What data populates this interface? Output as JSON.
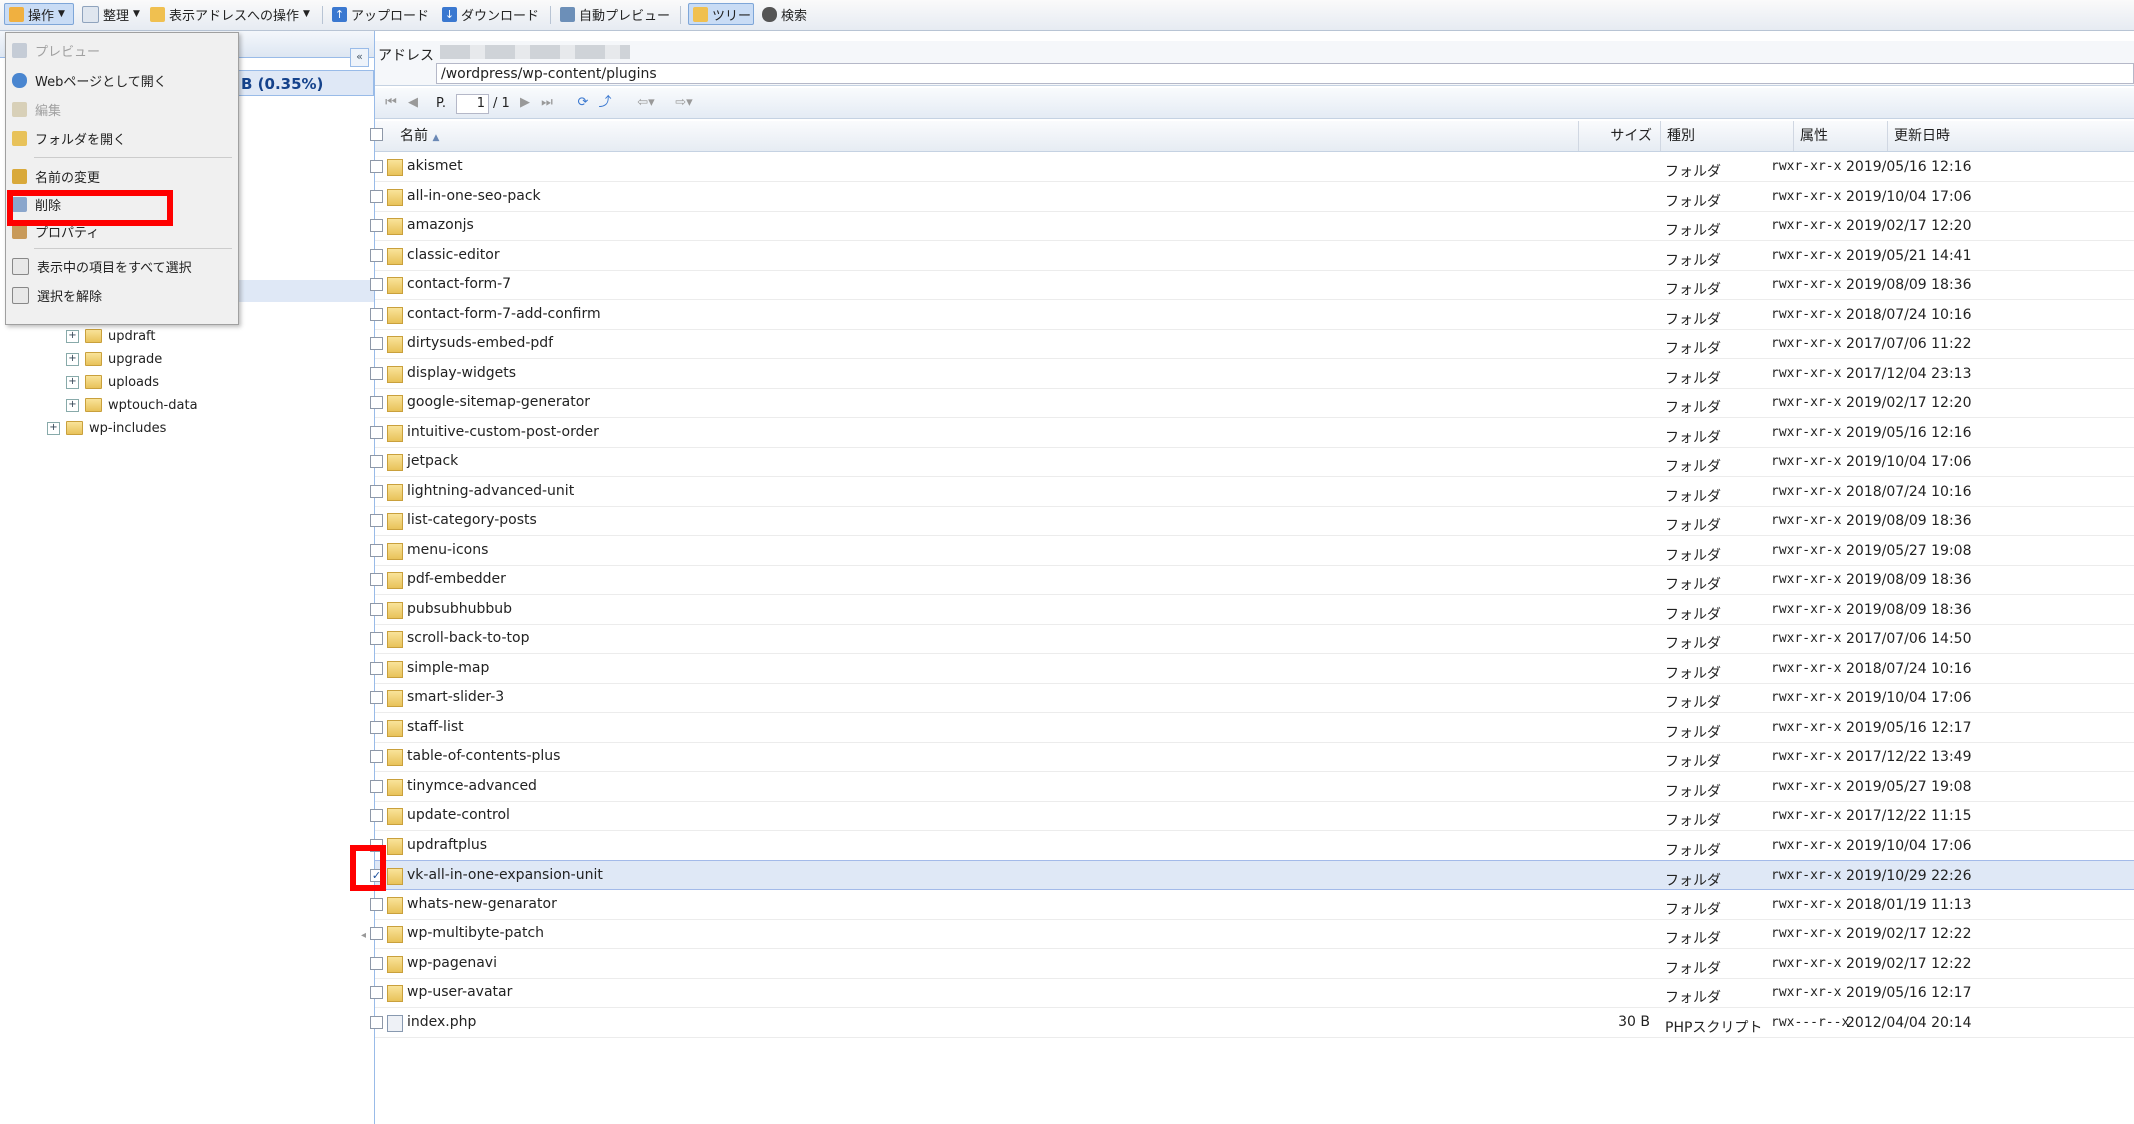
{
  "toolbar": {
    "operation": "操作",
    "organize": "整理",
    "address_ops": "表示アドレスへの操作",
    "upload": "アップロード",
    "download": "ダウンロード",
    "auto_preview": "自動プレビュー",
    "tree": "ツリー",
    "search": "検索"
  },
  "menu": {
    "items": [
      {
        "label": "プレビュー",
        "icon": "monitor-icon",
        "disabled": true
      },
      {
        "label": "Webページとして開く",
        "icon": "globe-page-icon",
        "disabled": false
      },
      {
        "label": "編集",
        "icon": "pencil-icon",
        "disabled": true
      },
      {
        "label": "フォルダを開く",
        "icon": "folder-open-icon",
        "disabled": false
      },
      {
        "label": "名前の変更",
        "icon": "pencil-icon",
        "disabled": false
      },
      {
        "label": "削除",
        "icon": "delete-icon",
        "disabled": false
      },
      {
        "label": "プロパティ",
        "icon": "properties-icon",
        "disabled": false
      },
      {
        "label": "表示中の項目をすべて選択",
        "icon": "cursor-icon",
        "disabled": false
      },
      {
        "label": "選択を解除",
        "icon": "cursor-icon",
        "disabled": false
      }
    ]
  },
  "left": {
    "quota": "B (0.35%)",
    "tree": [
      "updraft",
      "upgrade",
      "uploads",
      "wptouch-data",
      "wp-includes"
    ]
  },
  "address": {
    "label": "アドレス",
    "path": "/wordpress/wp-content/plugins"
  },
  "pager": {
    "prefix": "P.",
    "page": "1",
    "total": "/ 1"
  },
  "columns": {
    "name": "名前",
    "size": "サイズ",
    "type": "種別",
    "perm": "属性",
    "date": "更新日時"
  },
  "rows": [
    {
      "name": "akismet",
      "size": "",
      "type": "フォルダ",
      "perm": "rwxr-xr-x",
      "date": "2019/05/16 12:16",
      "checked": false
    },
    {
      "name": "all-in-one-seo-pack",
      "size": "",
      "type": "フォルダ",
      "perm": "rwxr-xr-x",
      "date": "2019/10/04 17:06",
      "checked": false
    },
    {
      "name": "amazonjs",
      "size": "",
      "type": "フォルダ",
      "perm": "rwxr-xr-x",
      "date": "2019/02/17 12:20",
      "checked": false
    },
    {
      "name": "classic-editor",
      "size": "",
      "type": "フォルダ",
      "perm": "rwxr-xr-x",
      "date": "2019/05/21 14:41",
      "checked": false
    },
    {
      "name": "contact-form-7",
      "size": "",
      "type": "フォルダ",
      "perm": "rwxr-xr-x",
      "date": "2019/08/09 18:36",
      "checked": false
    },
    {
      "name": "contact-form-7-add-confirm",
      "size": "",
      "type": "フォルダ",
      "perm": "rwxr-xr-x",
      "date": "2018/07/24 10:16",
      "checked": false
    },
    {
      "name": "dirtysuds-embed-pdf",
      "size": "",
      "type": "フォルダ",
      "perm": "rwxr-xr-x",
      "date": "2017/07/06 11:22",
      "checked": false
    },
    {
      "name": "display-widgets",
      "size": "",
      "type": "フォルダ",
      "perm": "rwxr-xr-x",
      "date": "2017/12/04 23:13",
      "checked": false
    },
    {
      "name": "google-sitemap-generator",
      "size": "",
      "type": "フォルダ",
      "perm": "rwxr-xr-x",
      "date": "2019/02/17 12:20",
      "checked": false
    },
    {
      "name": "intuitive-custom-post-order",
      "size": "",
      "type": "フォルダ",
      "perm": "rwxr-xr-x",
      "date": "2019/05/16 12:16",
      "checked": false
    },
    {
      "name": "jetpack",
      "size": "",
      "type": "フォルダ",
      "perm": "rwxr-xr-x",
      "date": "2019/10/04 17:06",
      "checked": false
    },
    {
      "name": "lightning-advanced-unit",
      "size": "",
      "type": "フォルダ",
      "perm": "rwxr-xr-x",
      "date": "2018/07/24 10:16",
      "checked": false
    },
    {
      "name": "list-category-posts",
      "size": "",
      "type": "フォルダ",
      "perm": "rwxr-xr-x",
      "date": "2019/08/09 18:36",
      "checked": false
    },
    {
      "name": "menu-icons",
      "size": "",
      "type": "フォルダ",
      "perm": "rwxr-xr-x",
      "date": "2019/05/27 19:08",
      "checked": false
    },
    {
      "name": "pdf-embedder",
      "size": "",
      "type": "フォルダ",
      "perm": "rwxr-xr-x",
      "date": "2019/08/09 18:36",
      "checked": false
    },
    {
      "name": "pubsubhubbub",
      "size": "",
      "type": "フォルダ",
      "perm": "rwxr-xr-x",
      "date": "2019/08/09 18:36",
      "checked": false
    },
    {
      "name": "scroll-back-to-top",
      "size": "",
      "type": "フォルダ",
      "perm": "rwxr-xr-x",
      "date": "2017/07/06 14:50",
      "checked": false
    },
    {
      "name": "simple-map",
      "size": "",
      "type": "フォルダ",
      "perm": "rwxr-xr-x",
      "date": "2018/07/24 10:16",
      "checked": false
    },
    {
      "name": "smart-slider-3",
      "size": "",
      "type": "フォルダ",
      "perm": "rwxr-xr-x",
      "date": "2019/10/04 17:06",
      "checked": false
    },
    {
      "name": "staff-list",
      "size": "",
      "type": "フォルダ",
      "perm": "rwxr-xr-x",
      "date": "2019/05/16 12:17",
      "checked": false
    },
    {
      "name": "table-of-contents-plus",
      "size": "",
      "type": "フォルダ",
      "perm": "rwxr-xr-x",
      "date": "2017/12/22 13:49",
      "checked": false
    },
    {
      "name": "tinymce-advanced",
      "size": "",
      "type": "フォルダ",
      "perm": "rwxr-xr-x",
      "date": "2019/05/27 19:08",
      "checked": false
    },
    {
      "name": "update-control",
      "size": "",
      "type": "フォルダ",
      "perm": "rwxr-xr-x",
      "date": "2017/12/22 11:15",
      "checked": false
    },
    {
      "name": "updraftplus",
      "size": "",
      "type": "フォルダ",
      "perm": "rwxr-xr-x",
      "date": "2019/10/04 17:06",
      "checked": false
    },
    {
      "name": "vk-all-in-one-expansion-unit",
      "size": "",
      "type": "フォルダ",
      "perm": "rwxr-xr-x",
      "date": "2019/10/29 22:26",
      "checked": true
    },
    {
      "name": "whats-new-genarator",
      "size": "",
      "type": "フォルダ",
      "perm": "rwxr-xr-x",
      "date": "2018/01/19 11:13",
      "checked": false
    },
    {
      "name": "wp-multibyte-patch",
      "size": "",
      "type": "フォルダ",
      "perm": "rwxr-xr-x",
      "date": "2019/02/17 12:22",
      "checked": false
    },
    {
      "name": "wp-pagenavi",
      "size": "",
      "type": "フォルダ",
      "perm": "rwxr-xr-x",
      "date": "2019/02/17 12:22",
      "checked": false
    },
    {
      "name": "wp-user-avatar",
      "size": "",
      "type": "フォルダ",
      "perm": "rwxr-xr-x",
      "date": "2019/05/16 12:17",
      "checked": false
    },
    {
      "name": "index.php",
      "size": "30 B",
      "type": "PHPスクリプト",
      "perm": "rwx---r--x",
      "date": "2012/04/04 20:14",
      "checked": false,
      "file": true
    }
  ]
}
